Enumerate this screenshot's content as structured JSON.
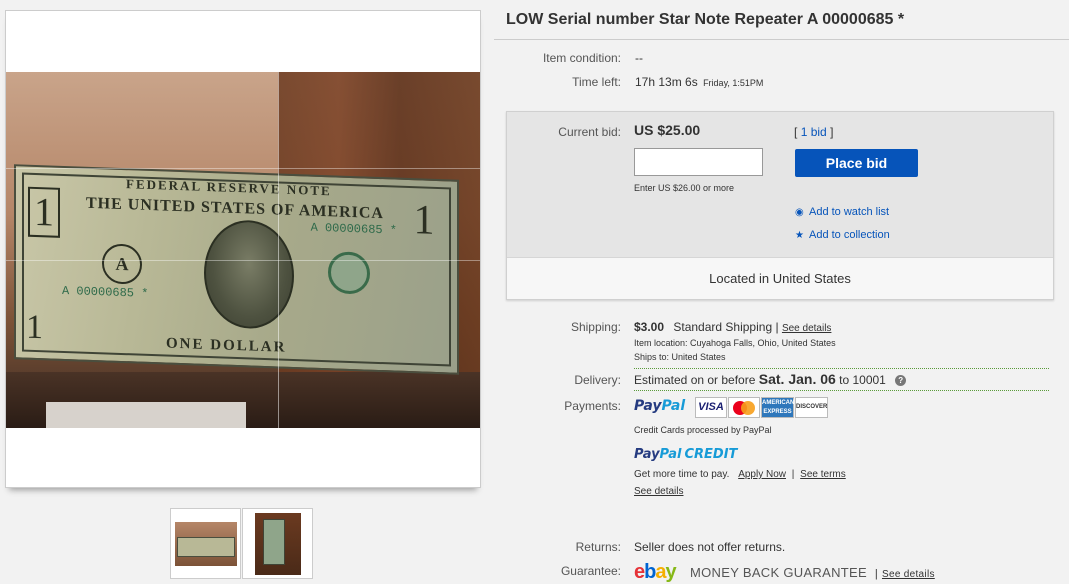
{
  "listing": {
    "title": "LOW Serial number Star Note Repeater A 00000685 *"
  },
  "photo": {
    "bill_header": "FEDERAL RESERVE NOTE",
    "bill_country": "THE UNITED STATES OF AMERICA",
    "bill_serial_top": "A 00000685 *",
    "bill_serial_bottom": "A 00000685 *",
    "bill_seal_letter": "A",
    "bill_denomination": "1",
    "bill_footer": "ONE DOLLAR"
  },
  "details": {
    "condition_label": "Item condition:",
    "condition_value": "--",
    "time_left_label": "Time left:",
    "time_left_value": "17h 13m 6s",
    "time_left_end": "Friday, 1:51PM"
  },
  "bid": {
    "current_bid_label": "Current bid:",
    "current_bid_value": "US $25.00",
    "bid_count_open": "[",
    "bid_count": "1 bid",
    "bid_count_close": "]",
    "input_value": "",
    "input_hint": "Enter US $26.00 or more",
    "place_bid_label": "Place bid",
    "watch_label": "Add to watch list",
    "collection_label": "Add to collection",
    "location": "Located in United States"
  },
  "shipping": {
    "label": "Shipping:",
    "cost": "$3.00",
    "method": "Standard Shipping",
    "sep": "|",
    "see_details": "See details",
    "item_location": "Item location:  Cuyahoga Falls, Ohio, United States",
    "ships_to": "Ships to:  United States"
  },
  "delivery": {
    "label": "Delivery:",
    "estimate_prefix": "Estimated on or before",
    "estimate_date": "Sat. Jan. 06",
    "estimate_suffix": "to 10001",
    "help": "?"
  },
  "payments": {
    "label": "Payments:",
    "paypal_pay": "Pay",
    "paypal_pal": "Pal",
    "cards": {
      "visa": "VISA",
      "amex": "AMERICAN EXPRESS",
      "discover": "DISCOVER"
    },
    "cards_note": "Credit Cards processed by PayPal",
    "credit_pay": "Pay",
    "credit_pal": "Pal",
    "credit_word": "CREDIT",
    "credit_text": "Get more time to pay.",
    "apply_now": "Apply Now",
    "sep": "|",
    "see_terms": "See terms",
    "see_details": "See details"
  },
  "returns": {
    "label": "Returns:",
    "value": "Seller does not offer returns."
  },
  "guarantee": {
    "label": "Guarantee:",
    "logo_e": "e",
    "logo_b": "b",
    "logo_a": "a",
    "logo_y": "y",
    "text": "MONEY BACK GUARANTEE",
    "sep": "|",
    "see_details": "See details"
  },
  "colors": {
    "accent": "#0654ba",
    "paypal_dark": "#253b80",
    "paypal_light": "#179bd7"
  }
}
